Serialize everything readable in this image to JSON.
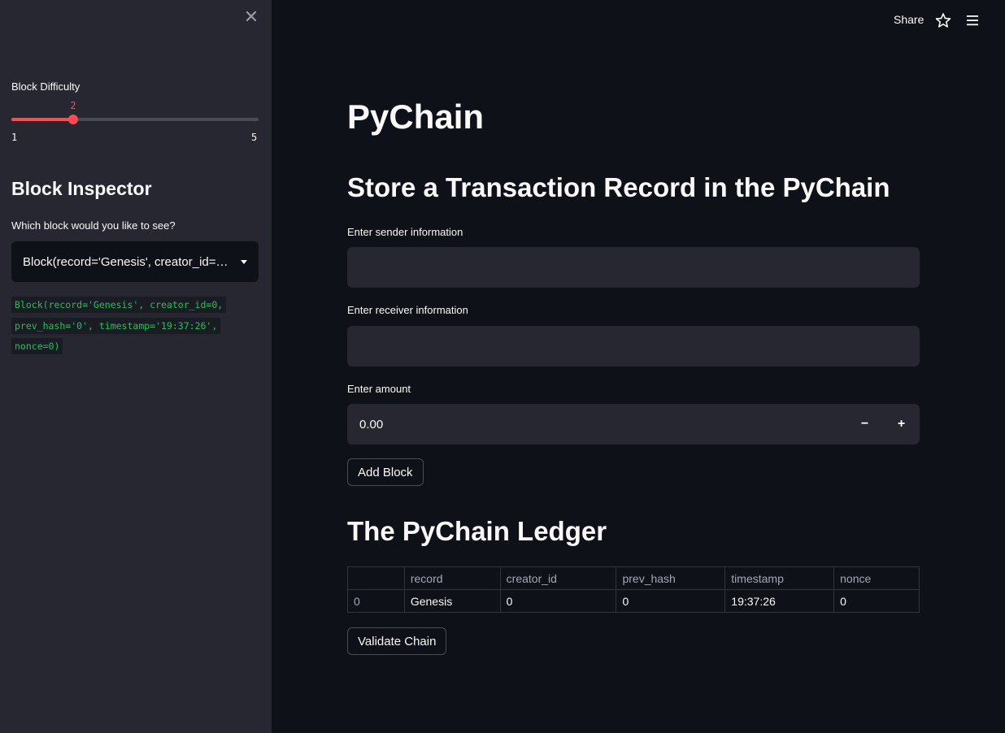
{
  "sidebar": {
    "slider": {
      "label": "Block Difficulty",
      "value": 2,
      "min": 1,
      "max": 5
    },
    "heading": "Block Inspector",
    "select": {
      "label": "Which block would you like to see?",
      "value": "Block(record='Genesis', creator_id=…"
    },
    "code_lines": [
      "Block(record='Genesis', creator_id=0,",
      "prev_hash='0', timestamp='19:37:26',",
      "nonce=0)"
    ]
  },
  "header": {
    "share_label": "Share",
    "star_icon": "star-icon",
    "menu_icon": "hamburger-menu-icon"
  },
  "main": {
    "title": "PyChain",
    "store_section_title": "Store a Transaction Record in the PyChain",
    "sender_label": "Enter sender information",
    "sender_value": "",
    "receiver_label": "Enter receiver information",
    "receiver_value": "",
    "amount_label": "Enter amount",
    "amount_value": "0.00",
    "minus_label": "−",
    "plus_label": "+",
    "add_block_label": "Add Block",
    "ledger_title": "The PyChain Ledger",
    "ledger": {
      "columns": [
        "",
        "record",
        "creator_id",
        "prev_hash",
        "timestamp",
        "nonce"
      ],
      "rows": [
        [
          "0",
          "Genesis",
          "0",
          "0",
          "19:37:26",
          "0"
        ]
      ]
    },
    "validate_label": "Validate Chain"
  },
  "colors": {
    "accent": "#ff4b4b",
    "code": "#21c354",
    "bg": "#0e1117",
    "sidebar_bg": "#262730"
  }
}
